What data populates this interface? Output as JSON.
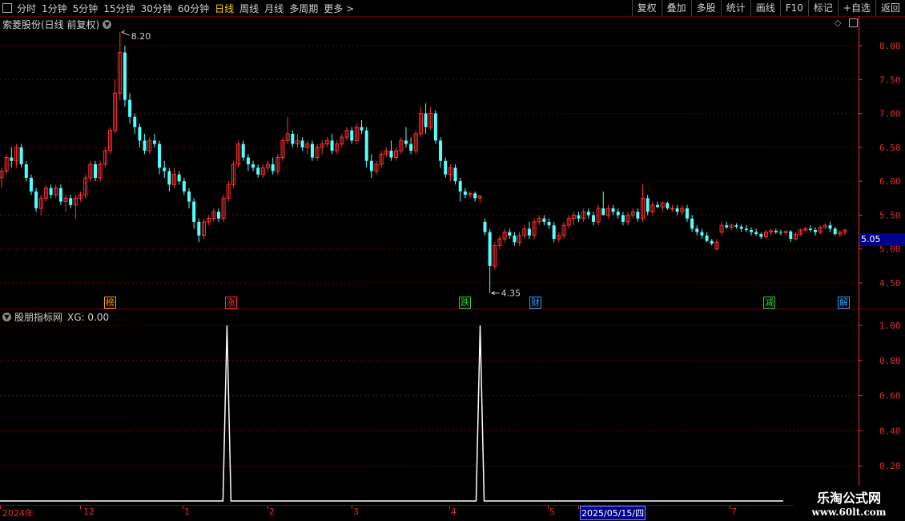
{
  "toolbar": {
    "periods": [
      {
        "label": "分时",
        "active": false
      },
      {
        "label": "1分钟",
        "active": false
      },
      {
        "label": "5分钟",
        "active": false
      },
      {
        "label": "15分钟",
        "active": false
      },
      {
        "label": "30分钟",
        "active": false
      },
      {
        "label": "60分钟",
        "active": false
      },
      {
        "label": "日线",
        "active": true
      },
      {
        "label": "周线",
        "active": false
      },
      {
        "label": "月线",
        "active": false
      },
      {
        "label": "多周期",
        "active": false
      },
      {
        "label": "更多 >",
        "active": false
      }
    ],
    "right_buttons": [
      "复权",
      "叠加",
      "多股",
      "统计",
      "画线",
      "F10",
      "标记",
      "+自选",
      "返回"
    ]
  },
  "main_pane": {
    "title": "索菱股份(日线 前复权)",
    "high_label": "8.20",
    "low_label": "4.35",
    "current_price": "5.05",
    "yaxis_ticks": [
      "8.00",
      "7.50",
      "7.00",
      "6.50",
      "6.00",
      "5.50",
      "5.00",
      "4.50"
    ],
    "events": [
      {
        "label": "榜",
        "color": "#ff9a00"
      },
      {
        "label": "涨",
        "color": "#ff3030"
      },
      {
        "label": "跌",
        "color": "#30d030"
      },
      {
        "label": "财",
        "color": "#30a0ff"
      },
      {
        "label": "减",
        "color": "#30d030"
      },
      {
        "label": "解",
        "color": "#30a0ff"
      }
    ]
  },
  "indicator_pane": {
    "title": "股朋指标网",
    "value_text": "XG: 0.00",
    "yaxis_ticks": [
      "1.00",
      "0.80",
      "0.60",
      "0.40",
      "0.20"
    ]
  },
  "date_axis": {
    "labels": [
      "2024年",
      "12",
      "1",
      "2",
      "3",
      "4",
      "5",
      "2025/05/15/四",
      "7"
    ]
  },
  "watermark": {
    "line1": "乐淘公式网",
    "line2": "www.60lt.com"
  },
  "colors": {
    "up": "#ff3030",
    "down": "#54ffff",
    "grid": "#7a0000",
    "axis": "#e03030",
    "signal": "#ffffff"
  },
  "chart_data": [
    {
      "type": "candlestick",
      "title": "索菱股份(日线 前复权)",
      "ylim": [
        4.2,
        8.4
      ],
      "ohlc": [
        [
          6.05,
          6.2,
          5.9,
          6.15
        ],
        [
          6.15,
          6.4,
          6.1,
          6.35
        ],
        [
          6.35,
          6.5,
          6.2,
          6.3
        ],
        [
          6.3,
          6.55,
          6.2,
          6.5
        ],
        [
          6.5,
          6.55,
          6.2,
          6.25
        ],
        [
          6.25,
          6.3,
          6.0,
          6.05
        ],
        [
          6.05,
          6.1,
          5.8,
          5.85
        ],
        [
          5.85,
          5.9,
          5.55,
          5.6
        ],
        [
          5.6,
          5.8,
          5.5,
          5.75
        ],
        [
          5.75,
          5.95,
          5.7,
          5.9
        ],
        [
          5.9,
          5.95,
          5.75,
          5.8
        ],
        [
          5.8,
          5.95,
          5.75,
          5.9
        ],
        [
          5.9,
          5.95,
          5.65,
          5.7
        ],
        [
          5.7,
          5.8,
          5.55,
          5.75
        ],
        [
          5.75,
          5.8,
          5.6,
          5.65
        ],
        [
          5.65,
          5.8,
          5.45,
          5.75
        ],
        [
          5.75,
          5.85,
          5.7,
          5.8
        ],
        [
          5.8,
          6.1,
          5.75,
          6.05
        ],
        [
          6.05,
          6.3,
          6.0,
          6.25
        ],
        [
          6.25,
          6.3,
          6.0,
          6.05
        ],
        [
          6.05,
          6.3,
          6.0,
          6.25
        ],
        [
          6.25,
          6.5,
          6.2,
          6.45
        ],
        [
          6.45,
          6.8,
          6.4,
          6.75
        ],
        [
          6.75,
          7.5,
          6.7,
          7.3
        ],
        [
          7.3,
          8.2,
          7.2,
          7.9
        ],
        [
          7.9,
          8.0,
          7.1,
          7.2
        ],
        [
          7.2,
          7.3,
          6.85,
          6.95
        ],
        [
          6.95,
          7.0,
          6.7,
          6.8
        ],
        [
          6.8,
          6.85,
          6.5,
          6.6
        ],
        [
          6.6,
          6.7,
          6.4,
          6.45
        ],
        [
          6.45,
          6.65,
          6.4,
          6.6
        ],
        [
          6.6,
          6.7,
          6.5,
          6.55
        ],
        [
          6.55,
          6.6,
          6.1,
          6.2
        ],
        [
          6.2,
          6.3,
          6.05,
          6.15
        ],
        [
          6.15,
          6.2,
          5.85,
          5.95
        ],
        [
          5.95,
          6.2,
          5.9,
          6.1
        ],
        [
          6.1,
          6.15,
          5.95,
          6.0
        ],
        [
          6.0,
          6.05,
          5.8,
          5.85
        ],
        [
          5.85,
          5.9,
          5.6,
          5.7
        ],
        [
          5.7,
          5.75,
          5.3,
          5.4
        ],
        [
          5.4,
          5.45,
          5.1,
          5.2
        ],
        [
          5.2,
          5.45,
          5.15,
          5.4
        ],
        [
          5.4,
          5.5,
          5.35,
          5.45
        ],
        [
          5.45,
          5.6,
          5.4,
          5.55
        ],
        [
          5.55,
          5.6,
          5.4,
          5.45
        ],
        [
          5.45,
          5.8,
          5.4,
          5.75
        ],
        [
          5.75,
          6.0,
          5.7,
          5.95
        ],
        [
          5.95,
          6.3,
          5.9,
          6.25
        ],
        [
          6.25,
          6.6,
          6.2,
          6.55
        ],
        [
          6.55,
          6.6,
          6.3,
          6.35
        ],
        [
          6.35,
          6.4,
          6.15,
          6.25
        ],
        [
          6.25,
          6.3,
          6.15,
          6.2
        ],
        [
          6.2,
          6.25,
          6.05,
          6.1
        ],
        [
          6.1,
          6.25,
          6.05,
          6.2
        ],
        [
          6.2,
          6.3,
          6.15,
          6.25
        ],
        [
          6.25,
          6.35,
          6.1,
          6.15
        ],
        [
          6.15,
          6.4,
          6.1,
          6.35
        ],
        [
          6.35,
          6.65,
          6.3,
          6.6
        ],
        [
          6.6,
          6.95,
          6.55,
          6.7
        ],
        [
          6.7,
          6.75,
          6.5,
          6.55
        ],
        [
          6.55,
          6.7,
          6.5,
          6.6
        ],
        [
          6.6,
          6.65,
          6.45,
          6.5
        ],
        [
          6.5,
          6.6,
          6.4,
          6.55
        ],
        [
          6.55,
          6.6,
          6.3,
          6.35
        ],
        [
          6.35,
          6.55,
          6.3,
          6.5
        ],
        [
          6.5,
          6.6,
          6.4,
          6.55
        ],
        [
          6.55,
          6.65,
          6.5,
          6.6
        ],
        [
          6.6,
          6.7,
          6.4,
          6.45
        ],
        [
          6.45,
          6.6,
          6.4,
          6.55
        ],
        [
          6.55,
          6.7,
          6.5,
          6.65
        ],
        [
          6.65,
          6.8,
          6.6,
          6.75
        ],
        [
          6.75,
          6.8,
          6.55,
          6.6
        ],
        [
          6.6,
          6.85,
          6.55,
          6.8
        ],
        [
          6.8,
          6.9,
          6.7,
          6.75
        ],
        [
          6.75,
          6.8,
          6.2,
          6.3
        ],
        [
          6.3,
          6.4,
          6.05,
          6.15
        ],
        [
          6.15,
          6.3,
          6.1,
          6.25
        ],
        [
          6.25,
          6.45,
          6.2,
          6.4
        ],
        [
          6.4,
          6.5,
          6.35,
          6.45
        ],
        [
          6.45,
          6.6,
          6.3,
          6.35
        ],
        [
          6.35,
          6.5,
          6.3,
          6.45
        ],
        [
          6.45,
          6.65,
          6.4,
          6.6
        ],
        [
          6.6,
          6.8,
          6.5,
          6.55
        ],
        [
          6.55,
          6.65,
          6.4,
          6.45
        ],
        [
          6.45,
          6.75,
          6.4,
          6.7
        ],
        [
          6.7,
          7.1,
          6.65,
          7.0
        ],
        [
          7.0,
          7.15,
          6.7,
          6.8
        ],
        [
          6.8,
          7.1,
          6.75,
          7.0
        ],
        [
          7.0,
          7.05,
          6.55,
          6.6
        ],
        [
          6.6,
          6.65,
          6.2,
          6.3
        ],
        [
          6.3,
          6.35,
          6.05,
          6.1
        ],
        [
          6.1,
          6.25,
          6.0,
          6.2
        ],
        [
          6.2,
          6.25,
          5.95,
          6.0
        ],
        [
          6.0,
          6.05,
          5.7,
          5.85
        ],
        [
          5.85,
          5.9,
          5.75,
          5.8
        ],
        [
          5.8,
          5.85,
          5.75,
          5.82
        ],
        [
          5.82,
          5.85,
          5.7,
          5.75
        ],
        [
          5.75,
          5.8,
          5.68,
          5.78
        ],
        [
          5.4,
          5.45,
          5.2,
          5.25
        ],
        [
          5.25,
          5.3,
          4.35,
          4.75
        ],
        [
          4.75,
          5.1,
          4.7,
          5.05
        ],
        [
          5.05,
          5.2,
          5.0,
          5.15
        ],
        [
          5.15,
          5.3,
          5.1,
          5.25
        ],
        [
          5.25,
          5.3,
          5.15,
          5.2
        ],
        [
          5.2,
          5.25,
          5.05,
          5.1
        ],
        [
          5.1,
          5.25,
          5.05,
          5.2
        ],
        [
          5.2,
          5.35,
          5.15,
          5.3
        ],
        [
          5.3,
          5.4,
          5.15,
          5.2
        ],
        [
          5.2,
          5.45,
          5.15,
          5.4
        ],
        [
          5.4,
          5.5,
          5.35,
          5.45
        ],
        [
          5.45,
          5.5,
          5.35,
          5.4
        ],
        [
          5.4,
          5.45,
          5.3,
          5.35
        ],
        [
          5.35,
          5.4,
          5.1,
          5.15
        ],
        [
          5.15,
          5.25,
          5.1,
          5.2
        ],
        [
          5.2,
          5.4,
          5.15,
          5.35
        ],
        [
          5.35,
          5.5,
          5.3,
          5.45
        ],
        [
          5.45,
          5.55,
          5.35,
          5.5
        ],
        [
          5.5,
          5.55,
          5.4,
          5.45
        ],
        [
          5.45,
          5.6,
          5.4,
          5.55
        ],
        [
          5.55,
          5.6,
          5.45,
          5.5
        ],
        [
          5.5,
          5.55,
          5.35,
          5.4
        ],
        [
          5.4,
          5.65,
          5.35,
          5.6
        ],
        [
          5.6,
          5.85,
          5.55,
          5.5
        ],
        [
          5.5,
          5.65,
          5.45,
          5.6
        ],
        [
          5.6,
          5.65,
          5.5,
          5.55
        ],
        [
          5.55,
          5.6,
          5.45,
          5.5
        ],
        [
          5.5,
          5.55,
          5.35,
          5.4
        ],
        [
          5.4,
          5.55,
          5.35,
          5.5
        ],
        [
          5.5,
          5.6,
          5.45,
          5.55
        ],
        [
          5.55,
          5.6,
          5.4,
          5.45
        ],
        [
          5.45,
          5.95,
          5.4,
          5.75
        ],
        [
          5.75,
          5.8,
          5.5,
          5.55
        ],
        [
          5.55,
          5.7,
          5.5,
          5.65
        ],
        [
          5.65,
          5.7,
          5.6,
          5.62
        ],
        [
          5.62,
          5.7,
          5.55,
          5.68
        ],
        [
          5.68,
          5.7,
          5.58,
          5.6
        ],
        [
          5.6,
          5.65,
          5.55,
          5.6
        ],
        [
          5.6,
          5.65,
          5.5,
          5.55
        ],
        [
          5.55,
          5.65,
          5.5,
          5.6
        ],
        [
          5.6,
          5.65,
          5.4,
          5.45
        ],
        [
          5.45,
          5.5,
          5.25,
          5.3
        ],
        [
          5.3,
          5.35,
          5.2,
          5.25
        ],
        [
          5.25,
          5.3,
          5.15,
          5.2
        ],
        [
          5.2,
          5.25,
          5.1,
          5.12
        ],
        [
          5.12,
          5.15,
          5.05,
          5.08
        ],
        [
          5.0,
          5.15,
          4.98,
          5.1
        ],
        [
          5.25,
          5.4,
          5.2,
          5.35
        ],
        [
          5.35,
          5.4,
          5.3,
          5.32
        ],
        [
          5.32,
          5.38,
          5.28,
          5.35
        ],
        [
          5.35,
          5.38,
          5.3,
          5.33
        ],
        [
          5.33,
          5.36,
          5.25,
          5.3
        ],
        [
          5.3,
          5.35,
          5.25,
          5.28
        ],
        [
          5.28,
          5.32,
          5.2,
          5.25
        ],
        [
          5.25,
          5.3,
          5.2,
          5.22
        ],
        [
          5.22,
          5.25,
          5.15,
          5.18
        ],
        [
          5.18,
          5.28,
          5.15,
          5.25
        ],
        [
          5.25,
          5.3,
          5.2,
          5.27
        ],
        [
          5.27,
          5.3,
          5.22,
          5.25
        ],
        [
          5.25,
          5.28,
          5.2,
          5.24
        ],
        [
          5.24,
          5.27,
          5.2,
          5.26
        ],
        [
          5.26,
          5.28,
          5.1,
          5.15
        ],
        [
          5.15,
          5.25,
          5.12,
          5.22
        ],
        [
          5.22,
          5.3,
          5.2,
          5.28
        ],
        [
          5.28,
          5.33,
          5.25,
          5.3
        ],
        [
          5.3,
          5.35,
          5.25,
          5.28
        ],
        [
          5.28,
          5.32,
          5.2,
          5.25
        ],
        [
          5.25,
          5.35,
          5.22,
          5.32
        ],
        [
          5.32,
          5.38,
          5.3,
          5.35
        ],
        [
          5.35,
          5.4,
          5.25,
          5.3
        ],
        [
          5.3,
          5.33,
          5.2,
          5.22
        ],
        [
          5.22,
          5.28,
          5.18,
          5.25
        ],
        [
          5.25,
          5.3,
          5.2,
          5.28
        ]
      ]
    },
    {
      "type": "line",
      "title": "股朋指标网",
      "series": [
        {
          "name": "XG",
          "values_note": "",
          "values": [
            0,
            1,
            0,
            1,
            0
          ]
        }
      ],
      "signal_positions_note": "",
      "signals": [
        {
          "position": 0.26,
          "value": 1
        },
        {
          "position": 0.55,
          "value": 1
        }
      ],
      "ylim": [
        0,
        1.05
      ]
    }
  ]
}
